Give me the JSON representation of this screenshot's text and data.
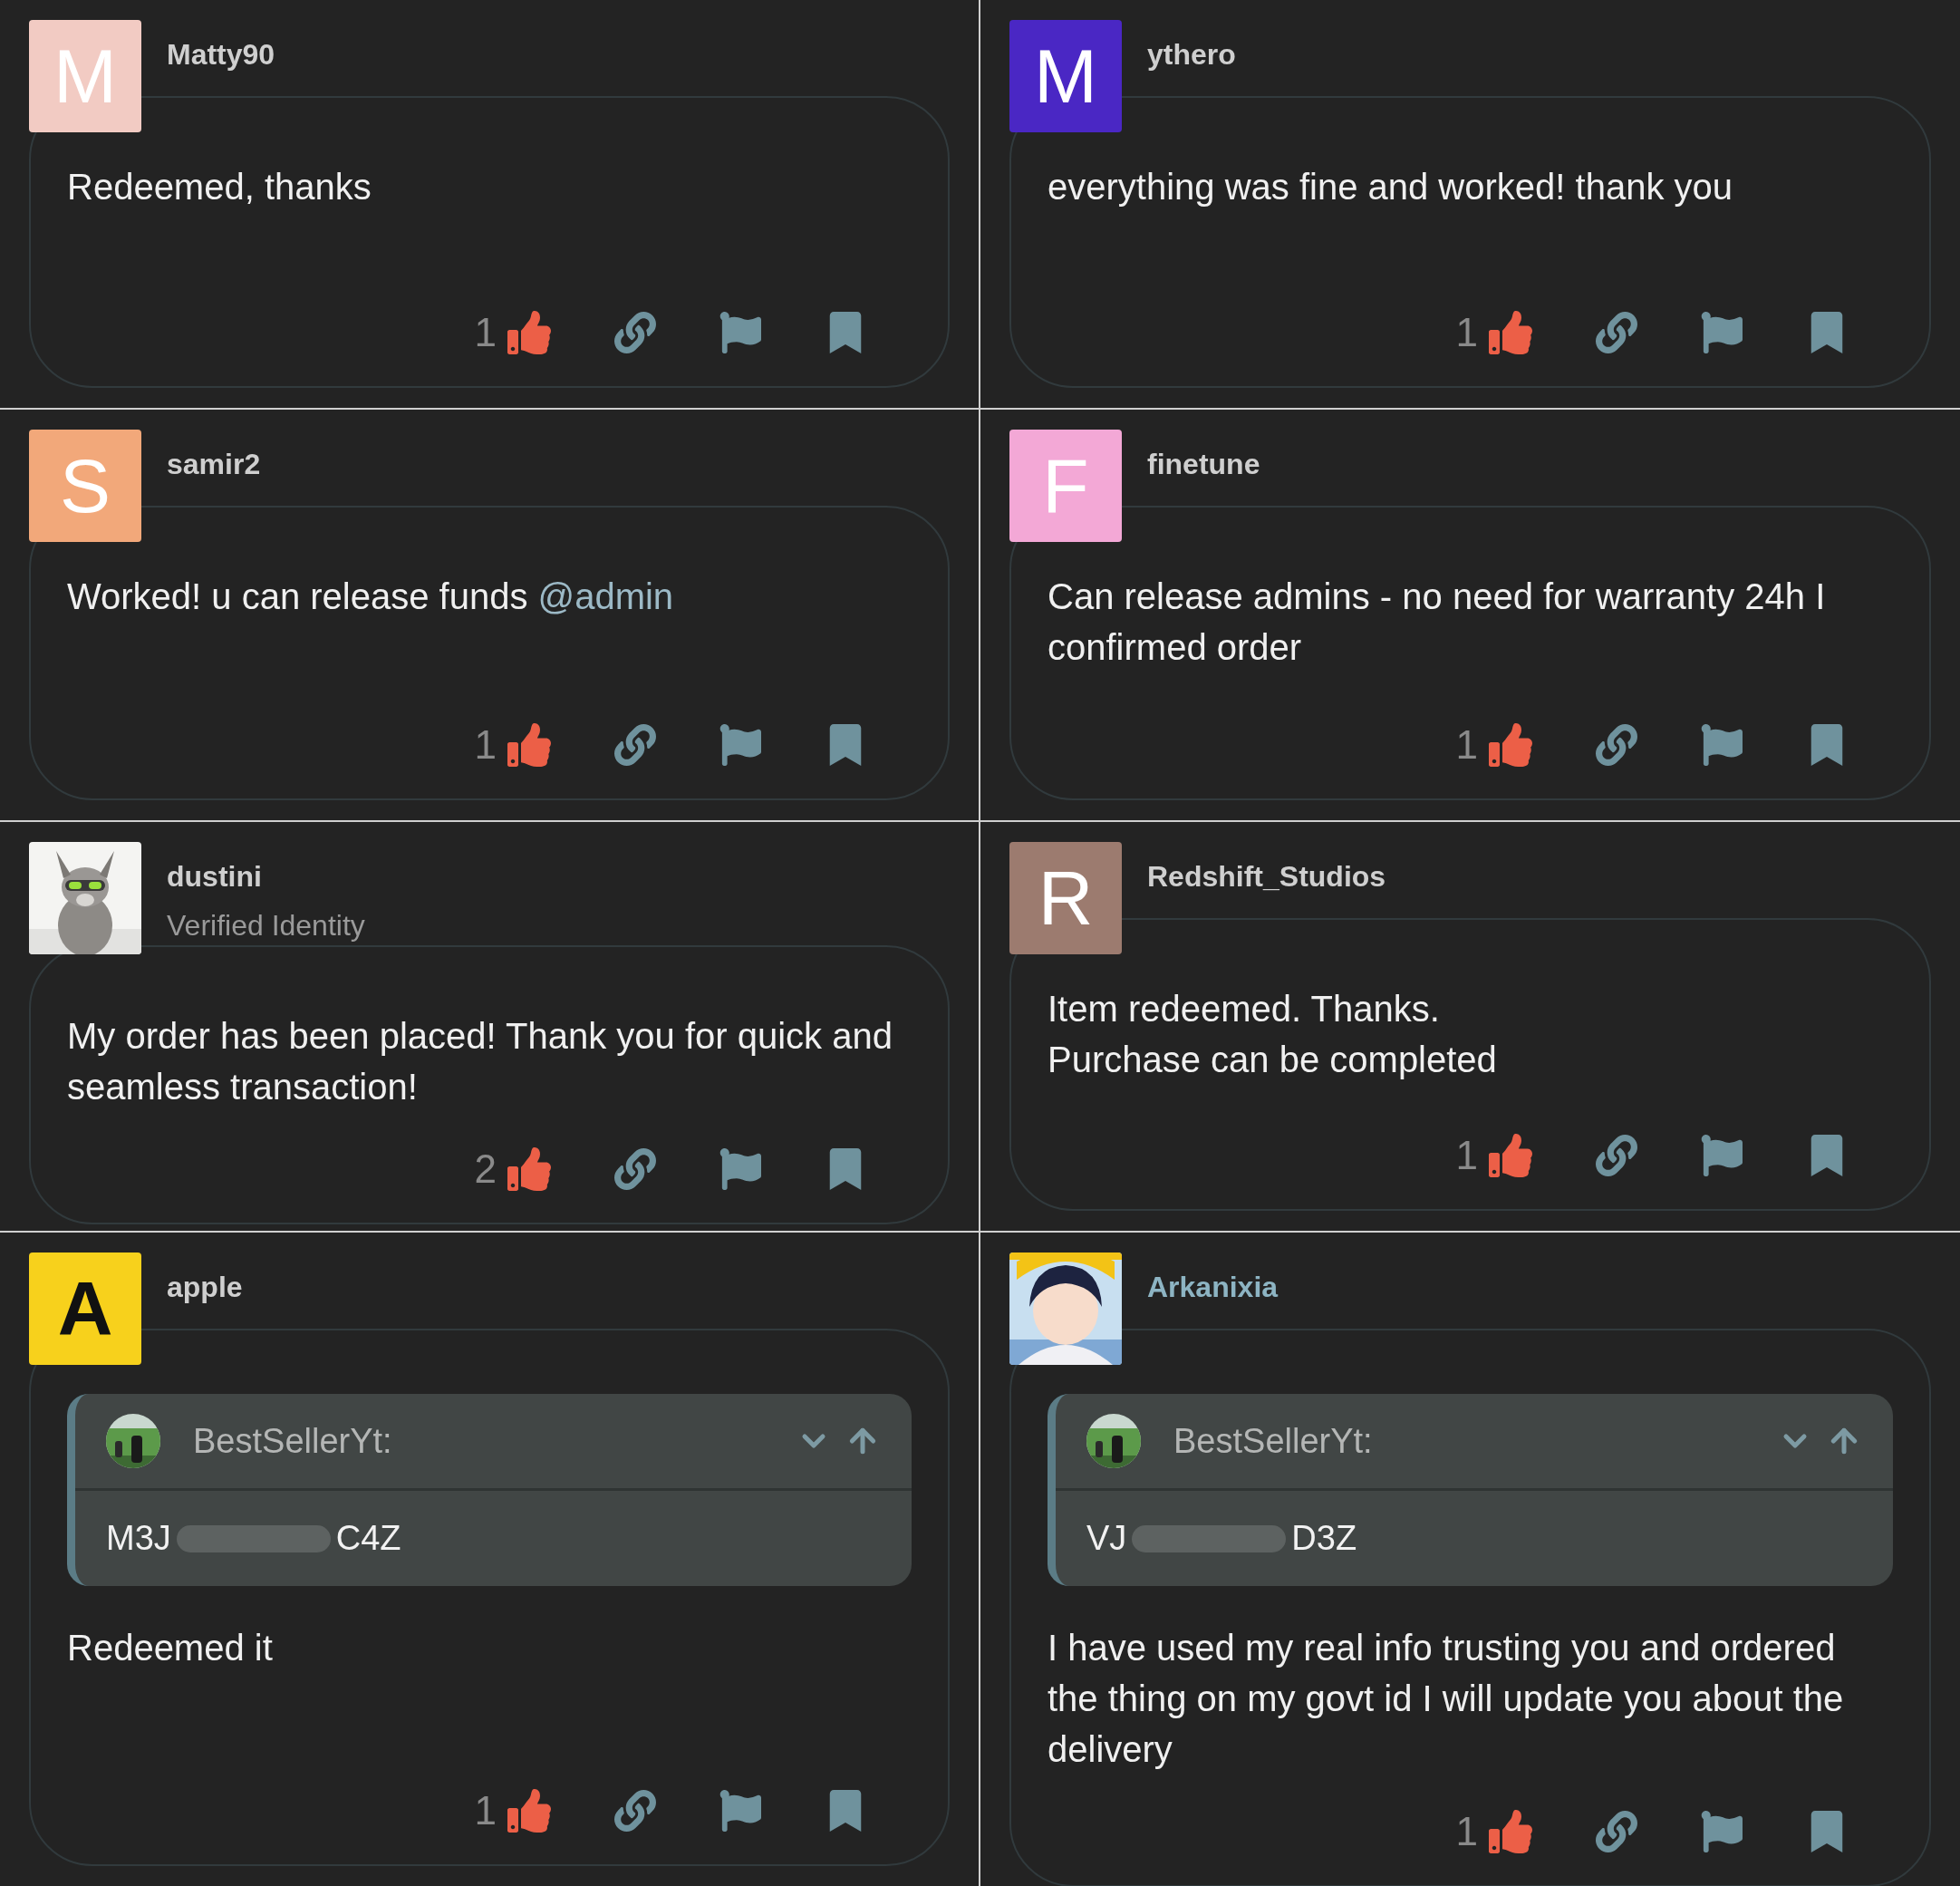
{
  "posts": [
    {
      "user": {
        "name": "Matty90",
        "color": "#cfcfcf"
      },
      "avatar": {
        "kind": "letter",
        "letter": "M",
        "color": "#f2cbc3"
      },
      "body": [
        "Redeemed, thanks"
      ],
      "likes": "1"
    },
    {
      "user": {
        "name": "ythero",
        "color": "#cfcfcf"
      },
      "avatar": {
        "kind": "letter",
        "letter": "M",
        "color": "#4a27c4"
      },
      "body": [
        "everything was fine and worked! thank you"
      ],
      "likes": "1"
    },
    {
      "user": {
        "name": "samir2",
        "color": "#cfcfcf"
      },
      "avatar": {
        "kind": "letter",
        "letter": "S",
        "color": "#f2a87a"
      },
      "body": [
        "Worked! u can release funds"
      ],
      "mention": "@admin",
      "likes": "1"
    },
    {
      "user": {
        "name": "finetune",
        "color": "#cfcfcf"
      },
      "avatar": {
        "kind": "letter",
        "letter": "F",
        "color": "#f3a8d6"
      },
      "body": [
        "Can release admins - no need for warranty 24h I confirmed order"
      ],
      "likes": "1"
    },
    {
      "user": {
        "name": "dustini",
        "color": "#cfcfcf"
      },
      "subtitle": "Verified Identity",
      "avatar": {
        "kind": "animal_picture"
      },
      "body": [
        "My order has been placed! Thank you for quick and seamless transaction!"
      ],
      "likes": "2"
    },
    {
      "user": {
        "name": "Redshift_Studios",
        "color": "#cfcfcf"
      },
      "avatar": {
        "kind": "letter",
        "letter": "R",
        "color": "#9c7b6f"
      },
      "body": [
        "Item redeemed. Thanks.",
        "Purchase can be completed"
      ],
      "likes": "1"
    },
    {
      "user": {
        "name": "apple",
        "color": "#cfcfcf"
      },
      "avatar": {
        "kind": "letter_dark",
        "letter": "A",
        "color": "#f7d11c"
      },
      "quote": {
        "author": "BestSellerYt:",
        "code_start": "M3J",
        "code_end": "C4Z"
      },
      "body": [
        "Redeemed it"
      ],
      "likes": "1"
    },
    {
      "user": {
        "name": "Arkanixia",
        "color": "#8db4c3"
      },
      "avatar": {
        "kind": "figure_picture"
      },
      "quote": {
        "author": "BestSellerYt:",
        "code_start": "VJ",
        "code_end": "D3Z"
      },
      "body": [
        "I have used my real info trusting you and ordered the thing on my govt id I will update you about the delivery"
      ],
      "likes": "1"
    }
  ]
}
